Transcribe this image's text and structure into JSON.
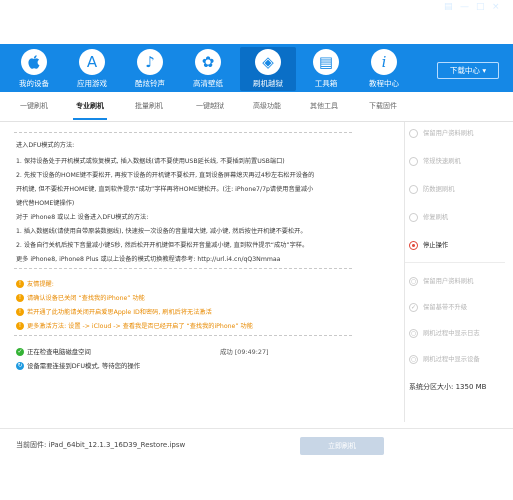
{
  "topbar": {
    "items": [
      {
        "label": "我的设备",
        "icon": ""
      },
      {
        "label": "应用游戏",
        "icon": "A"
      },
      {
        "label": "酷炫铃声",
        "icon": "♪"
      },
      {
        "label": "高清壁纸",
        "icon": "✿"
      },
      {
        "label": "刷机越狱",
        "icon": "◈"
      },
      {
        "label": "工具箱",
        "icon": "▤"
      },
      {
        "label": "教程中心",
        "icon": "i"
      }
    ],
    "active_index": 4,
    "download_label": "下载中心",
    "download_arrow": "▾",
    "util_icons": [
      "▤",
      "—",
      "□",
      "×"
    ]
  },
  "subtabs": {
    "items": [
      "一键刷机",
      "专业刷机",
      "批量刷机",
      "一键越狱",
      "高级功能",
      "其他工具",
      "下载固件"
    ],
    "active_index": 1
  },
  "main": {
    "instructions": [
      "进入DFU模式的方法:",
      "1. 保持设备处于开机模式或恢复模式, 插入数据线(请不要使用USB延长线, 不要插到前置USB端口)",
      "2. 先按下设备的HOME键不要松开, 再按下设备的开机键不要松开, 直到设备屏幕熄灭再过4秒左右松开设备的",
      "开机键, 但不要松开HOME键, 直到软件提示“成功”字样再将HOME键松开。(注: iPhone7/7p请使用音量减小",
      "键代替HOME键操作)",
      "对于 iPhone8 或以上 设备进入DFU模式的方法:",
      "1. 插入数据线(请使用自带原装数据线), 快速按一次设备的音量增大键, 减小键, 然后按住开机键不要松开。",
      "2. 设备自行关机后按下音量减小键5秒, 然后松开开机键但不要松开音量减小键, 直到软件提示“成功”字样。",
      "更多 iPhone8, iPhone8 Plus 或以上设备的模式切换教程请参考: http://url.i4.cn/qQ3Nmmaa"
    ],
    "tips": [
      "友情提醒:",
      "请确认设备已关闭 “查找我的iPhone” 功能",
      "若开通了此功能请关闭开启爱思Apple ID和密码, 刷机后将无法激活",
      "更多激活方法: 设置 -> iCloud -> 查看我是否已经开启了 “查找我的iPhone” 功能"
    ],
    "status": [
      {
        "text": "正在检查电脑磁盘空间",
        "time": "成功 [09:49:27]",
        "color": "#35b336",
        "icon": "✓"
      },
      {
        "text": "设备需要连接到DFU模式, 等待您的操作",
        "time": "",
        "color": "#1e9ae0",
        "icon": "↻"
      }
    ]
  },
  "sidebar": {
    "options_top": [
      {
        "label": "保留用户资料刷机",
        "state": "off"
      },
      {
        "label": "常规快速刷机",
        "state": "off"
      },
      {
        "label": "防数据刷机",
        "state": "off"
      },
      {
        "label": "修复刷机",
        "state": "off"
      }
    ],
    "active_option": "停止操作",
    "options_bottom": [
      {
        "label": "保留用户资料刷机",
        "icon": "○"
      },
      {
        "label": "保留基带不升级",
        "icon": "✓"
      },
      {
        "label": "刷机过程中显示日志",
        "icon": "○"
      },
      {
        "label": "刷机过程中显示设备",
        "icon": "○"
      }
    ],
    "partition_label": "系统分区大小: 1350 MB"
  },
  "footer": {
    "firmware_label": "当前固件: iPad_64bit_12.1.3_16D39_Restore.ipsw",
    "flash_button": "立即刷机"
  }
}
